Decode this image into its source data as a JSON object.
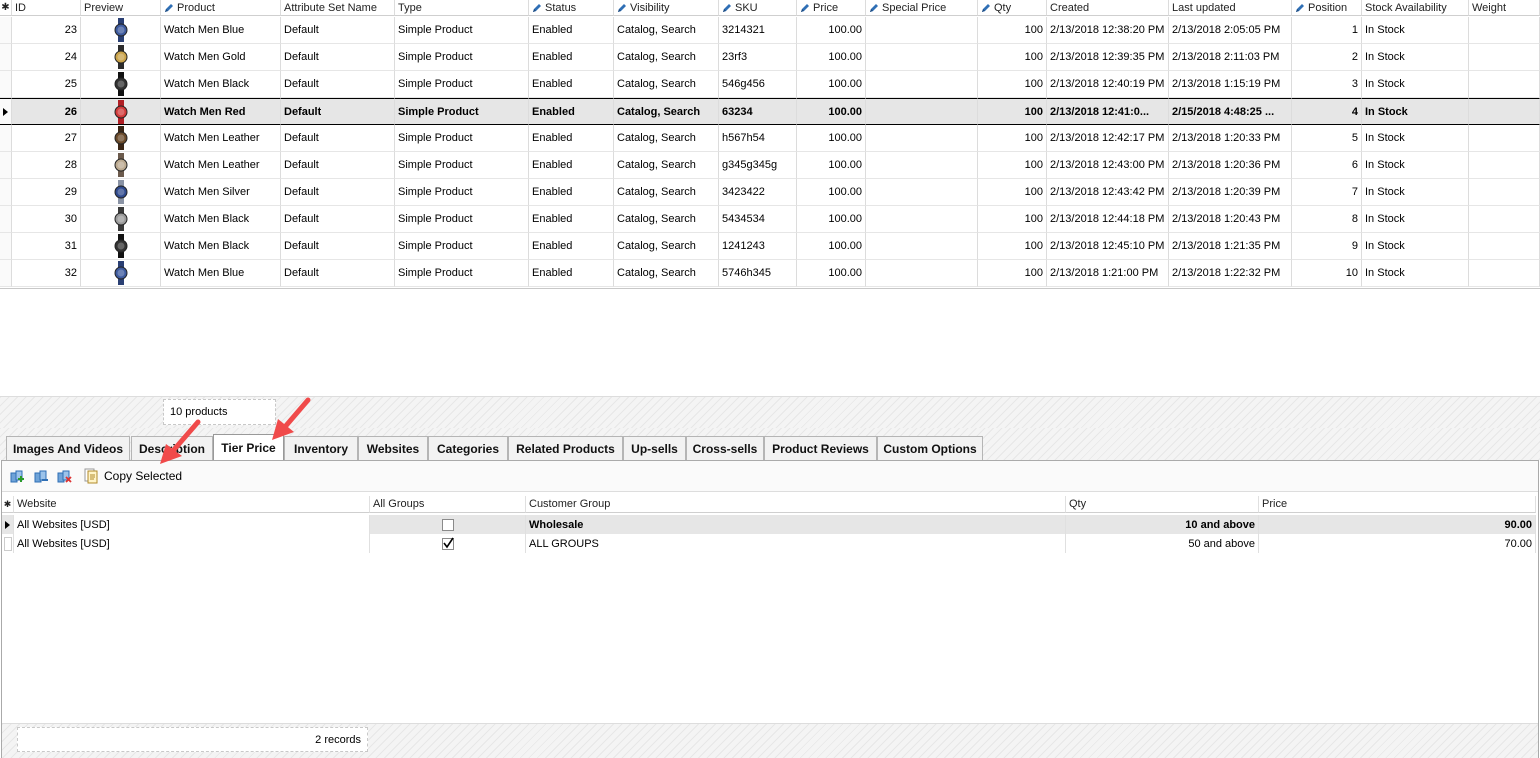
{
  "grid": {
    "columns": [
      {
        "key": "id",
        "label": "ID",
        "editable": false
      },
      {
        "key": "preview",
        "label": "Preview",
        "editable": false
      },
      {
        "key": "product",
        "label": "Product",
        "editable": true
      },
      {
        "key": "attr_set",
        "label": "Attribute Set Name",
        "editable": false
      },
      {
        "key": "type",
        "label": "Type",
        "editable": false
      },
      {
        "key": "status",
        "label": "Status",
        "editable": true
      },
      {
        "key": "visibility",
        "label": "Visibility",
        "editable": true
      },
      {
        "key": "sku",
        "label": "SKU",
        "editable": true
      },
      {
        "key": "price",
        "label": "Price",
        "editable": true
      },
      {
        "key": "special_price",
        "label": "Special Price",
        "editable": true
      },
      {
        "key": "qty",
        "label": "Qty",
        "editable": true
      },
      {
        "key": "created",
        "label": "Created",
        "editable": false
      },
      {
        "key": "updated",
        "label": "Last updated",
        "editable": false
      },
      {
        "key": "position",
        "label": "Position",
        "editable": true
      },
      {
        "key": "stock",
        "label": "Stock Availability",
        "editable": false
      },
      {
        "key": "weight",
        "label": "Weight",
        "editable": false
      }
    ],
    "rows": [
      {
        "id": "23",
        "preview": "watch-blue",
        "product": "Watch Men Blue",
        "attr_set": "Default",
        "type": "Simple Product",
        "status": "Enabled",
        "visibility": "Catalog, Search",
        "sku": "3214321",
        "price": "100.00",
        "special_price": "",
        "qty": "100",
        "created": "2/13/2018 12:38:20 PM",
        "updated": "2/13/2018 2:05:05 PM",
        "position": "1",
        "stock": "In Stock",
        "weight": ""
      },
      {
        "id": "24",
        "preview": "watch-gold",
        "product": "Watch Men Gold",
        "attr_set": "Default",
        "type": "Simple Product",
        "status": "Enabled",
        "visibility": "Catalog, Search",
        "sku": "23rf3",
        "price": "100.00",
        "special_price": "",
        "qty": "100",
        "created": "2/13/2018 12:39:35 PM",
        "updated": "2/13/2018 2:11:03 PM",
        "position": "2",
        "stock": "In Stock",
        "weight": ""
      },
      {
        "id": "25",
        "preview": "watch-black",
        "product": "Watch Men Black",
        "attr_set": "Default",
        "type": "Simple Product",
        "status": "Enabled",
        "visibility": "Catalog, Search",
        "sku": "546g456",
        "price": "100.00",
        "special_price": "",
        "qty": "100",
        "created": "2/13/2018 12:40:19 PM",
        "updated": "2/13/2018 1:15:19 PM",
        "position": "3",
        "stock": "In Stock",
        "weight": ""
      },
      {
        "id": "26",
        "preview": "watch-red",
        "product": "Watch Men Red",
        "attr_set": "Default",
        "type": "Simple Product",
        "status": "Enabled",
        "visibility": "Catalog, Search",
        "sku": "63234",
        "price": "100.00",
        "special_price": "",
        "qty": "100",
        "created": "2/13/2018 12:41:0...",
        "updated": "2/15/2018 4:48:25 ...",
        "position": "4",
        "stock": "In Stock",
        "weight": "",
        "selected": true
      },
      {
        "id": "27",
        "preview": "watch-leather",
        "product": "Watch Men Leather",
        "attr_set": "Default",
        "type": "Simple Product",
        "status": "Enabled",
        "visibility": "Catalog, Search",
        "sku": "h567h54",
        "price": "100.00",
        "special_price": "",
        "qty": "100",
        "created": "2/13/2018 12:42:17 PM",
        "updated": "2/13/2018 1:20:33 PM",
        "position": "5",
        "stock": "In Stock",
        "weight": ""
      },
      {
        "id": "28",
        "preview": "watch-leather-light",
        "product": "Watch Men Leather",
        "attr_set": "Default",
        "type": "Simple Product",
        "status": "Enabled",
        "visibility": "Catalog, Search",
        "sku": "g345g345g",
        "price": "100.00",
        "special_price": "",
        "qty": "100",
        "created": "2/13/2018 12:43:00 PM",
        "updated": "2/13/2018 1:20:36 PM",
        "position": "6",
        "stock": "In Stock",
        "weight": ""
      },
      {
        "id": "29",
        "preview": "watch-silver",
        "product": "Watch Men Silver",
        "attr_set": "Default",
        "type": "Simple Product",
        "status": "Enabled",
        "visibility": "Catalog, Search",
        "sku": "3423422",
        "price": "100.00",
        "special_price": "",
        "qty": "100",
        "created": "2/13/2018 12:43:42 PM",
        "updated": "2/13/2018 1:20:39 PM",
        "position": "7",
        "stock": "In Stock",
        "weight": ""
      },
      {
        "id": "30",
        "preview": "watch-black-steel",
        "product": "Watch Men Black",
        "attr_set": "Default",
        "type": "Simple Product",
        "status": "Enabled",
        "visibility": "Catalog, Search",
        "sku": "5434534",
        "price": "100.00",
        "special_price": "",
        "qty": "100",
        "created": "2/13/2018 12:44:18 PM",
        "updated": "2/13/2018 1:20:43 PM",
        "position": "8",
        "stock": "In Stock",
        "weight": ""
      },
      {
        "id": "31",
        "preview": "watch-black",
        "product": "Watch Men Black",
        "attr_set": "Default",
        "type": "Simple Product",
        "status": "Enabled",
        "visibility": "Catalog, Search",
        "sku": "1241243",
        "price": "100.00",
        "special_price": "",
        "qty": "100",
        "created": "2/13/2018 12:45:10 PM",
        "updated": "2/13/2018 1:21:35 PM",
        "position": "9",
        "stock": "In Stock",
        "weight": ""
      },
      {
        "id": "32",
        "preview": "watch-blue",
        "product": "Watch Men Blue",
        "attr_set": "Default",
        "type": "Simple Product",
        "status": "Enabled",
        "visibility": "Catalog, Search",
        "sku": "5746h345",
        "price": "100.00",
        "special_price": "",
        "qty": "100",
        "created": "2/13/2018 1:21:00 PM",
        "updated": "2/13/2018 1:22:32 PM",
        "position": "10",
        "stock": "In Stock",
        "weight": ""
      }
    ],
    "footer_count": "10 products"
  },
  "tabs": [
    {
      "label": "Images And Videos",
      "active": false
    },
    {
      "label": "Description",
      "active": false
    },
    {
      "label": "Tier Price",
      "active": true
    },
    {
      "label": "Inventory",
      "active": false
    },
    {
      "label": "Websites",
      "active": false
    },
    {
      "label": "Categories",
      "active": false
    },
    {
      "label": "Related Products",
      "active": false
    },
    {
      "label": "Up-sells",
      "active": false
    },
    {
      "label": "Cross-sells",
      "active": false
    },
    {
      "label": "Product Reviews",
      "active": false
    },
    {
      "label": "Custom Options",
      "active": false
    }
  ],
  "toolbar": {
    "icons": [
      "add-row-icon",
      "insert-row-icon",
      "delete-row-icon"
    ],
    "copy_label": "Copy Selected"
  },
  "tier_price": {
    "columns": [
      "Website",
      "All Groups",
      "Customer Group",
      "Qty",
      "Price"
    ],
    "rows": [
      {
        "website": "All Websites [USD]",
        "all_groups": false,
        "customer_group": "Wholesale",
        "qty": "10 and above",
        "price": "90.00",
        "selected": true
      },
      {
        "website": "All Websites [USD]",
        "all_groups": true,
        "customer_group": "ALL GROUPS",
        "qty": "50 and above",
        "price": "70.00",
        "selected": false
      }
    ],
    "records": "2 records"
  },
  "colors": {
    "arrow": "#f04a4a",
    "selected_row_bg": "#e6e6e6",
    "pencil": "#2f6fb5"
  }
}
